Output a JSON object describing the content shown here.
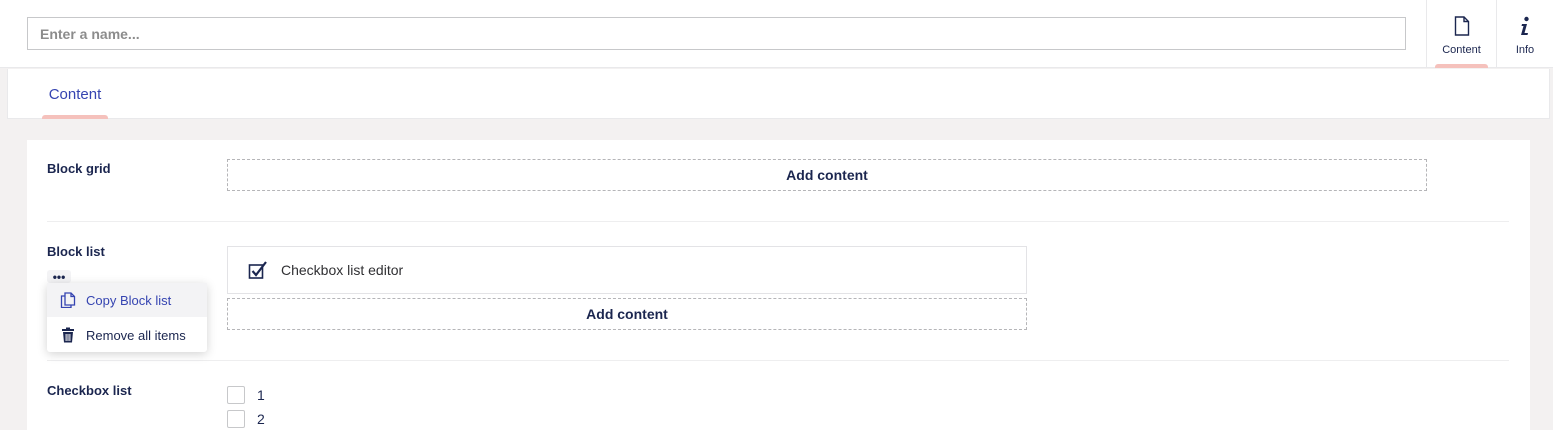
{
  "header": {
    "name_placeholder": "Enter a name...",
    "apps": [
      {
        "label": "Content",
        "icon": "document-icon",
        "active": true
      },
      {
        "label": "Info",
        "icon": "info-icon",
        "active": false
      }
    ]
  },
  "tabs": [
    {
      "label": "Content",
      "active": true
    }
  ],
  "properties": {
    "block_grid": {
      "label": "Block grid",
      "add_label": "Add content"
    },
    "block_list": {
      "label": "Block list",
      "more_label": "•••",
      "items": [
        {
          "label": "Checkbox list editor",
          "icon": "checkbox-icon"
        }
      ],
      "add_label": "Add content",
      "menu": [
        {
          "label": "Copy Block list",
          "icon": "copy-icon"
        },
        {
          "label": "Remove all items",
          "icon": "trash-icon"
        }
      ]
    },
    "checkbox_list": {
      "label": "Checkbox list",
      "options": [
        {
          "label": "1",
          "checked": false
        },
        {
          "label": "2",
          "checked": false
        }
      ]
    }
  },
  "colors": {
    "accent": "#3544b1",
    "active_indicator": "#f5c1bc",
    "text": "#1b264f",
    "background": "#f3f1f1"
  }
}
